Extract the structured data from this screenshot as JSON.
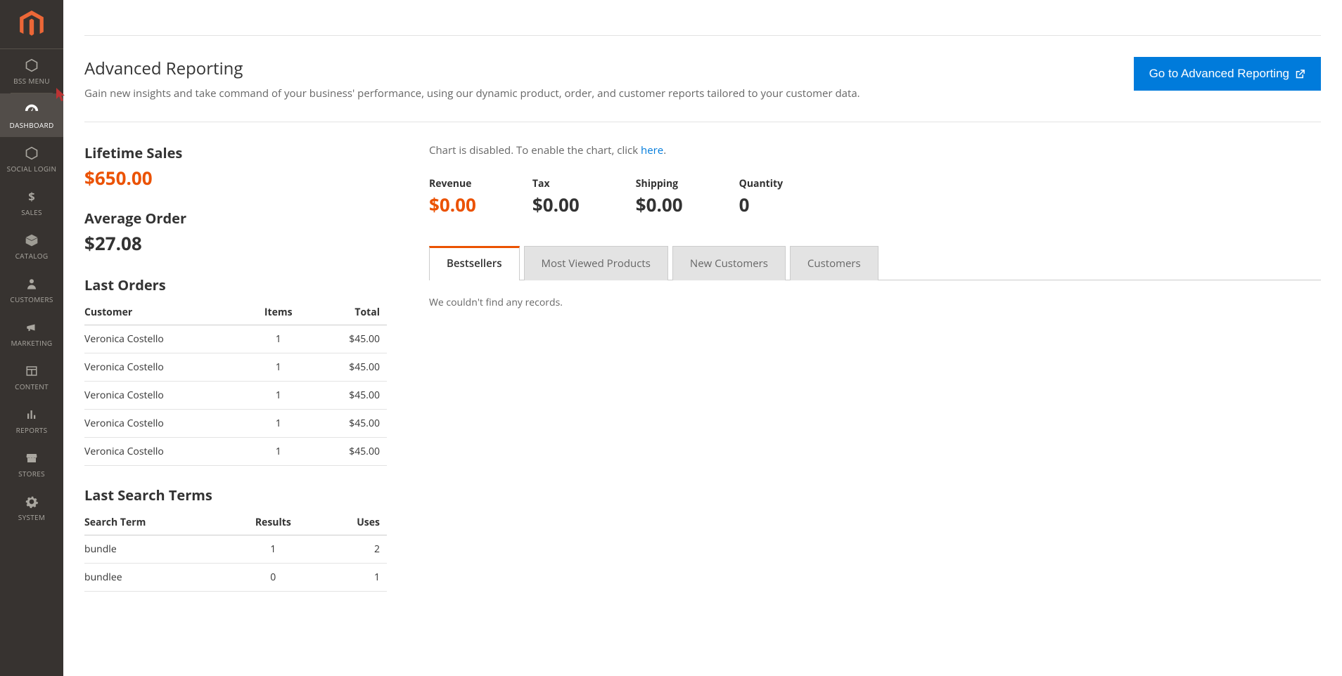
{
  "sidebar": {
    "items": [
      {
        "label": "BSS MENU",
        "icon": "hexagon"
      },
      {
        "label": "DASHBOARD",
        "icon": "dashboard",
        "active": true
      },
      {
        "label": "SOCIAL LOGIN",
        "icon": "hexagon"
      },
      {
        "label": "SALES",
        "icon": "dollar"
      },
      {
        "label": "CATALOG",
        "icon": "box"
      },
      {
        "label": "CUSTOMERS",
        "icon": "person"
      },
      {
        "label": "MARKETING",
        "icon": "megaphone"
      },
      {
        "label": "CONTENT",
        "icon": "layout"
      },
      {
        "label": "REPORTS",
        "icon": "bars"
      },
      {
        "label": "STORES",
        "icon": "storefront"
      },
      {
        "label": "SYSTEM",
        "icon": "gear"
      }
    ]
  },
  "advanced": {
    "title": "Advanced Reporting",
    "desc": "Gain new insights and take command of your business' performance, using our dynamic product, order, and customer reports tailored to your customer data.",
    "button": "Go to Advanced Reporting"
  },
  "lifetime": {
    "title": "Lifetime Sales",
    "value": "$650.00"
  },
  "average": {
    "title": "Average Order",
    "value": "$27.08"
  },
  "lastOrders": {
    "title": "Last Orders",
    "headers": {
      "customer": "Customer",
      "items": "Items",
      "total": "Total"
    },
    "rows": [
      {
        "customer": "Veronica Costello",
        "items": "1",
        "total": "$45.00"
      },
      {
        "customer": "Veronica Costello",
        "items": "1",
        "total": "$45.00"
      },
      {
        "customer": "Veronica Costello",
        "items": "1",
        "total": "$45.00"
      },
      {
        "customer": "Veronica Costello",
        "items": "1",
        "total": "$45.00"
      },
      {
        "customer": "Veronica Costello",
        "items": "1",
        "total": "$45.00"
      }
    ]
  },
  "lastSearch": {
    "title": "Last Search Terms",
    "headers": {
      "term": "Search Term",
      "results": "Results",
      "uses": "Uses"
    },
    "rows": [
      {
        "term": "bundle",
        "results": "1",
        "uses": "2"
      },
      {
        "term": "bundlee",
        "results": "0",
        "uses": "1"
      }
    ]
  },
  "chartNote": {
    "prefix": "Chart is disabled. To enable the chart, click ",
    "link": "here",
    "suffix": "."
  },
  "metrics": {
    "revenue": {
      "label": "Revenue",
      "value": "$0.00"
    },
    "tax": {
      "label": "Tax",
      "value": "$0.00"
    },
    "shipping": {
      "label": "Shipping",
      "value": "$0.00"
    },
    "quantity": {
      "label": "Quantity",
      "value": "0"
    }
  },
  "tabs": {
    "items": [
      "Bestsellers",
      "Most Viewed Products",
      "New Customers",
      "Customers"
    ],
    "activeIndex": 0,
    "emptyMsg": "We couldn't find any records."
  }
}
